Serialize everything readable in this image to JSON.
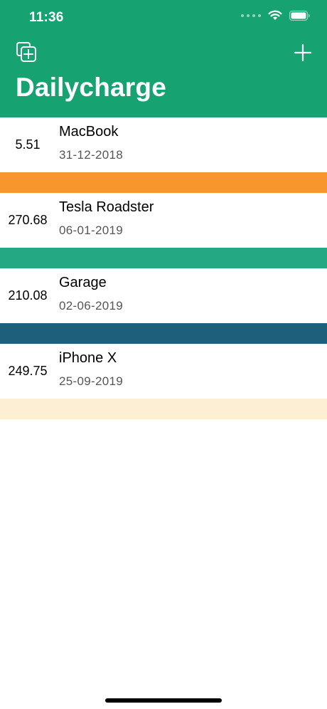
{
  "status": {
    "time": "11:36"
  },
  "nav": {
    "title": "Dailycharge",
    "left_icon": "duplicate-icon",
    "right_icon": "plus-icon"
  },
  "colors": {
    "header": "#17a271",
    "bands": [
      "#f7962c",
      "#23a883",
      "#1e607b",
      "#fdefd4"
    ]
  },
  "items": [
    {
      "amount": "5.51",
      "name": "MacBook",
      "date": "31-12-2018"
    },
    {
      "amount": "270.68",
      "name": "Tesla Roadster",
      "date": "06-01-2019"
    },
    {
      "amount": "210.08",
      "name": "Garage",
      "date": "02-06-2019"
    },
    {
      "amount": "249.75",
      "name": "iPhone X",
      "date": "25-09-2019"
    }
  ]
}
